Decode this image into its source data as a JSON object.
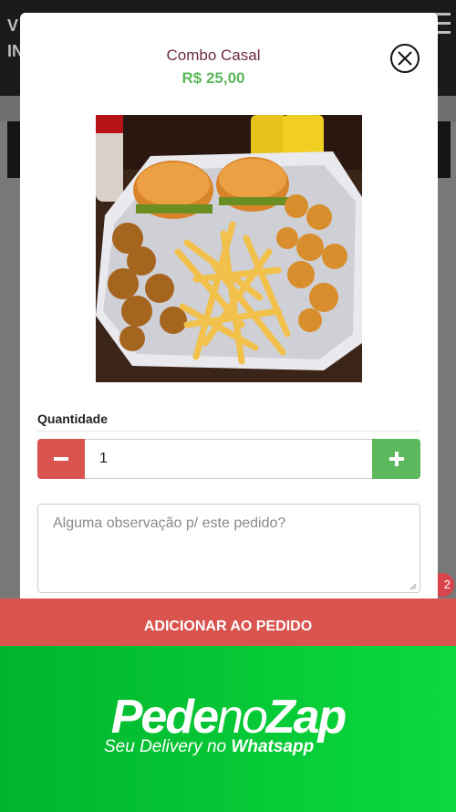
{
  "background": {
    "header_line1": "V",
    "header_line2": "IN",
    "cart_badge": "2"
  },
  "product": {
    "name": "Combo Casal",
    "price": "R$ 25,00",
    "image_icon": "food-photo"
  },
  "quantity": {
    "label": "Quantidade",
    "value": "1"
  },
  "observation": {
    "placeholder": "Alguma observação p/ este pedido?"
  },
  "add_button": {
    "label": "ADICIONAR AO PEDIDO"
  },
  "banner": {
    "brand_part1": "Pede",
    "brand_part2": "no",
    "brand_part3": "Zap",
    "tagline_prefix": "Seu Delivery no ",
    "tagline_bold": "Whatsapp"
  },
  "colors": {
    "accent_red": "#d9534f",
    "accent_green": "#5cb85c",
    "title_color": "#6b2a4a",
    "banner_green": "#0bd93d"
  }
}
